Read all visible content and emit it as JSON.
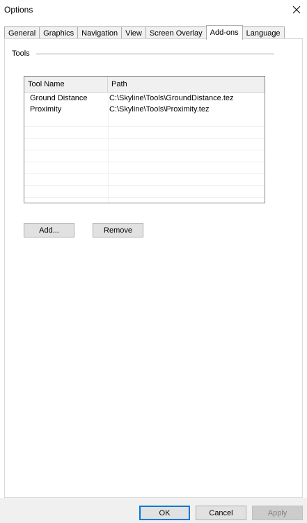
{
  "window": {
    "title": "Options"
  },
  "tabs": [
    {
      "label": "General",
      "active": false
    },
    {
      "label": "Graphics",
      "active": false
    },
    {
      "label": "Navigation",
      "active": false
    },
    {
      "label": "View",
      "active": false
    },
    {
      "label": "Screen Overlay",
      "active": false
    },
    {
      "label": "Add-ons",
      "active": true
    },
    {
      "label": "Language",
      "active": false
    }
  ],
  "tools_group": {
    "label": "Tools",
    "columns": [
      "Tool Name",
      "Path"
    ],
    "rows": [
      {
        "name": "Ground Distance",
        "path": "C:\\Skyline\\Tools\\GroundDistance.tez"
      },
      {
        "name": "Proximity",
        "path": "C:\\Skyline\\Tools\\Proximity.tez"
      }
    ],
    "add_label": "Add...",
    "remove_label": "Remove"
  },
  "footer": {
    "ok_label": "OK",
    "cancel_label": "Cancel",
    "apply_label": "Apply"
  },
  "colors": {
    "accent": "#0078d7",
    "disabled_text": "#838383"
  }
}
